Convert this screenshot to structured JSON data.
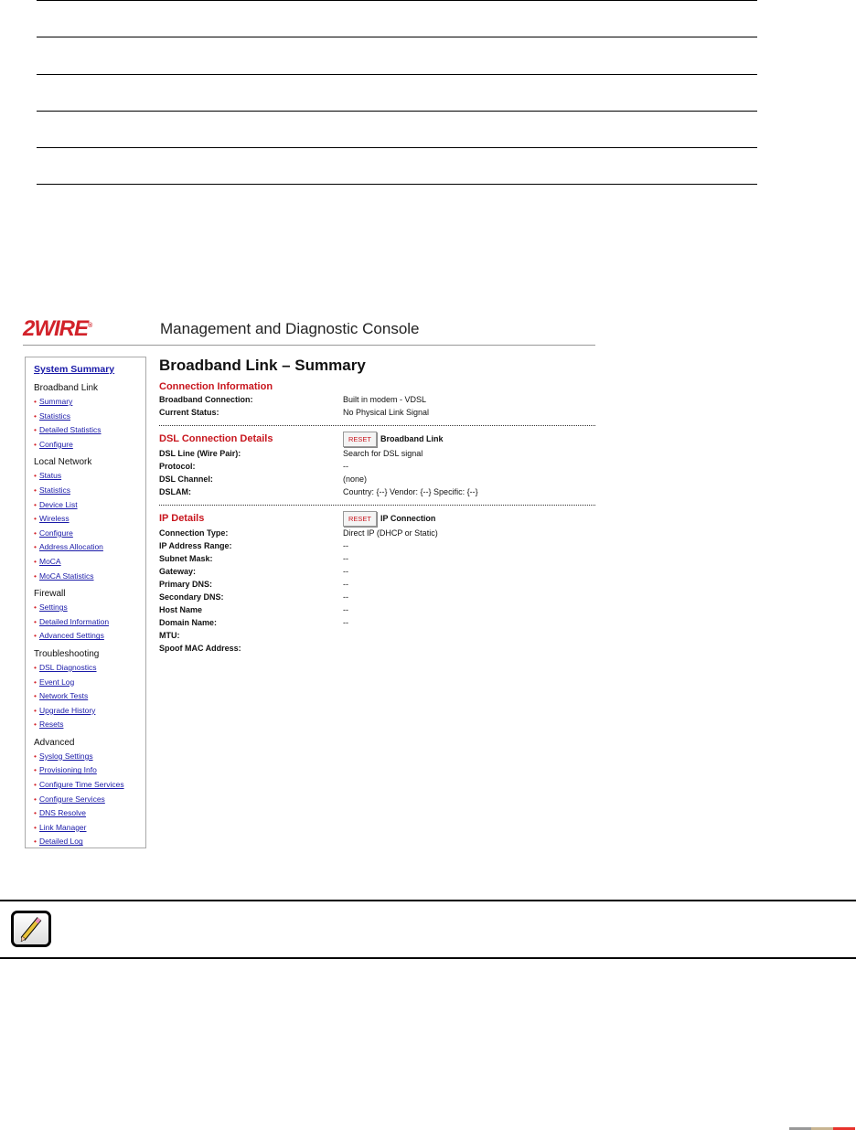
{
  "console": {
    "logo": "2WIRE",
    "title": "Management and Diagnostic Console"
  },
  "sidebar": {
    "system_summary": "System Summary",
    "sections": [
      {
        "title": "Broadband Link",
        "items": [
          "Summary",
          "Statistics",
          "Detailed Statistics",
          "Configure"
        ]
      },
      {
        "title": "Local Network",
        "items": [
          "Status",
          "Statistics",
          "Device List",
          "Wireless",
          "Configure",
          "Address Allocation",
          "MoCA",
          "MoCA Statistics"
        ]
      },
      {
        "title": "Firewall",
        "items": [
          "Settings",
          "Detailed Information",
          "Advanced Settings"
        ]
      },
      {
        "title": "Troubleshooting",
        "items": [
          "DSL Diagnostics",
          "Event Log",
          "Network Tests",
          "Upgrade History",
          "Resets"
        ]
      },
      {
        "title": "Advanced",
        "items": [
          "Syslog Settings",
          "Provisioning Info",
          "Configure Time Services",
          "Configure Services",
          "DNS Resolve",
          "Link Manager",
          "Detailed Log"
        ]
      }
    ]
  },
  "main": {
    "title": "Broadband Link – Summary",
    "connection": {
      "heading": "Connection Information",
      "rows": [
        [
          "Broadband Connection:",
          "Built in modem - VDSL"
        ],
        [
          "Current Status:",
          "No Physical Link Signal"
        ]
      ]
    },
    "dsl": {
      "heading": "DSL Connection Details",
      "reset": "RESET",
      "reset_label": "Broadband Link",
      "rows": [
        [
          "DSL Line (Wire Pair):",
          "Search for DSL signal"
        ],
        [
          "Protocol:",
          "--"
        ],
        [
          "DSL Channel:",
          "(none)"
        ],
        [
          "DSLAM:",
          "Country: {--} Vendor: {--} Specific: {--}"
        ]
      ]
    },
    "ip": {
      "heading": "IP Details",
      "reset": "RESET",
      "reset_label": "IP Connection",
      "rows": [
        [
          "Connection Type:",
          "Direct IP (DHCP or Static)"
        ],
        [
          "IP Address Range:",
          "--"
        ],
        [
          "Subnet Mask:",
          "--"
        ],
        [
          "Gateway:",
          "--"
        ],
        [
          "Primary DNS:",
          "--"
        ],
        [
          "Secondary DNS:",
          "--"
        ],
        [
          "Host Name",
          "--"
        ],
        [
          "Domain Name:",
          "--"
        ],
        [
          "MTU:",
          ""
        ],
        [
          "Spoof MAC Address:",
          ""
        ]
      ]
    }
  },
  "colors": {
    "brand": "#d2222a",
    "link": "#1a1aa8"
  }
}
